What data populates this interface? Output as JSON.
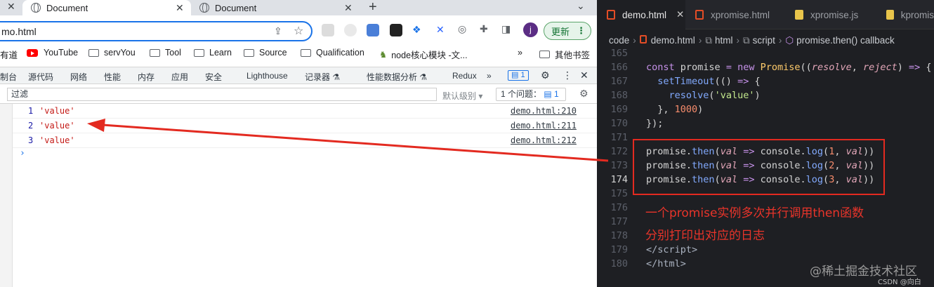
{
  "browser": {
    "tabs": [
      {
        "title": "Document"
      },
      {
        "title": "Document"
      }
    ],
    "address": "mo.html",
    "update_label": "更新",
    "avatar_letter": "j",
    "bookmarks": [
      "有道",
      "YouTube",
      "servYou",
      "Tool",
      "Learn",
      "Source",
      "Qualification",
      "node核心模块 -文...",
      "其他书签"
    ],
    "devtools_tabs": [
      "制台",
      "源代码",
      "网络",
      "性能",
      "内存",
      "应用",
      "安全",
      "Lighthouse",
      "记录器 ⚗",
      "性能数据分析 ⚗",
      "Redux"
    ],
    "devtools_badge": "1",
    "filter_placeholder": "过滤",
    "levels_label": "默认级别",
    "issues_label": "1 个问题：",
    "issues_count": "1",
    "console_rows": [
      {
        "num": "1",
        "value": "'value'",
        "source": "demo.html:210"
      },
      {
        "num": "2",
        "value": "'value'",
        "source": "demo.html:211"
      },
      {
        "num": "3",
        "value": "'value'",
        "source": "demo.html:212"
      }
    ],
    "prompt": "›"
  },
  "editor": {
    "tabs": [
      {
        "name": "demo.html",
        "type": "html",
        "active": true
      },
      {
        "name": "xpromise.html",
        "type": "html",
        "active": false
      },
      {
        "name": "xpromise.js",
        "type": "js",
        "active": false
      },
      {
        "name": "kpromis",
        "type": "js",
        "active": false
      }
    ],
    "breadcrumb": [
      "code",
      "demo.html",
      "html",
      "script",
      "promise.then() callback"
    ],
    "line_numbers": [
      "165",
      "166",
      "167",
      "168",
      "169",
      "170",
      "171",
      "172",
      "173",
      "174",
      "175",
      "176",
      "177",
      "178",
      "179",
      "180"
    ],
    "current_line": "174"
  },
  "annotation": {
    "line1": "一个promise实例多次并行调用then函数",
    "line2": "分别打印出对应的日志"
  },
  "watermark": {
    "main": "@稀土掘金技术社区",
    "small": "CSDN @向白"
  },
  "colors": {
    "accent_red": "#e32a20",
    "editor_bg": "#1e1f23",
    "console_string": "#c41a16"
  }
}
